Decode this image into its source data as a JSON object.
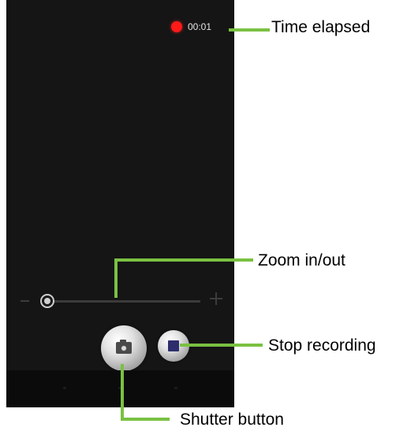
{
  "recording": {
    "time": "00:01"
  },
  "zoom": {
    "level": 0
  },
  "callouts": {
    "time_elapsed": "Time elapsed",
    "zoom": "Zoom in/out",
    "stop": "Stop recording",
    "shutter": "Shutter button"
  },
  "colors": {
    "callout_line": "#7ac142",
    "record_dot": "#ff1a1a",
    "screen": "#151515"
  },
  "icons": {
    "shutter": "camera-icon",
    "stop": "stop-icon",
    "record": "record-dot-icon"
  }
}
